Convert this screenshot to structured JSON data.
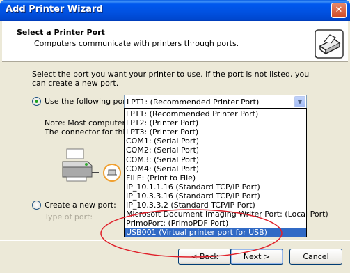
{
  "window": {
    "title": "Add Printer Wizard",
    "close_glyph": "✕"
  },
  "header": {
    "title": "Select a Printer Port",
    "subtitle": "Computers communicate with printers through ports."
  },
  "instructions": "Select the port you want your printer to use.  If the port is not listed, you can create a new port.",
  "use_port": {
    "label": "Use the following port:",
    "selected": "LPT1: (Recommended Printer Port)",
    "checked": true
  },
  "note": {
    "line1": "Note: Most computers u",
    "line2": "The connector for this p"
  },
  "port_options": [
    "LPT1: (Recommended Printer Port)",
    "LPT2: (Printer Port)",
    "LPT3: (Printer Port)",
    "COM1: (Serial Port)",
    "COM2: (Serial Port)",
    "COM3: (Serial Port)",
    "COM4: (Serial Port)",
    "FILE: (Print to File)",
    "IP_10.1.1.16 (Standard TCP/IP Port)",
    "IP_10.3.3.16 (Standard TCP/IP Port)",
    "IP_10.3.3.2 (Standard TCP/IP Port)",
    "Microsoft Document Imaging Writer Port: (Local Port)",
    "PrimoPort: (PrimoPDF Port)",
    "USB001 (Virtual printer port for USB)"
  ],
  "highlighted_index": 13,
  "create_port": {
    "label": "Create a new port:",
    "type_label": "Type of port:",
    "checked": false
  },
  "buttons": {
    "back": "< Back",
    "next": "Next >",
    "cancel": "Cancel"
  },
  "colors": {
    "accent": "#316ac5",
    "annotation": "#e0202a",
    "titlebar": "#0058ee"
  }
}
